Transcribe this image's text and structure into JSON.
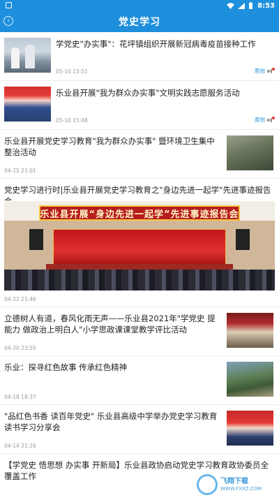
{
  "status_bar": {
    "time": "8:53"
  },
  "header": {
    "title": "党史学习",
    "back_icon": "back-arrow-icon"
  },
  "items": [
    {
      "title": "学党史\"办实事\"：花坪镇组织开展新冠病毒疫苗接种工作",
      "time": "05-10 15:51",
      "tool_label": "原创"
    },
    {
      "title": "乐业县开展\"我为群众办实事\"文明实践志愿服务活动",
      "time": "05-10 15:48",
      "tool_label": "原创"
    },
    {
      "title": "乐业县开展党史学习教育\"我为群众办实事\" 暨环境卫生集中整治活动",
      "time": "04-25 21:01"
    },
    {
      "title": "党史学习进行时|乐业县开展党史学习教育之\"身边先进一起学\"先进事迹报告会",
      "time": "04-22 21:46",
      "banner_sign": "乐业县开展“身边先进一起学”先进事迹报告会"
    },
    {
      "title": "立德树人有道，春风化雨无声——乐业县2021年\"学党史 提能力 做政治上明白人\"小学思政课课堂教学评比活动",
      "time": "04-20 23:55"
    },
    {
      "title": "乐业：探寻红色故事 传承红色精神",
      "time": "04-18 18:37"
    },
    {
      "title": "\"品红色书香 读百年党史\" 乐业县高级中学举办党史学习教育读书学习分享会",
      "time": "04-14 21:26"
    },
    {
      "title": "【学党史 悟思想 办实事 开新局】乐业县政协启动党史学习教育政协委员全覆盖工作"
    }
  ],
  "watermark": {
    "text": "飞翔下载",
    "sub": "WWW.FXXZ.COM"
  }
}
